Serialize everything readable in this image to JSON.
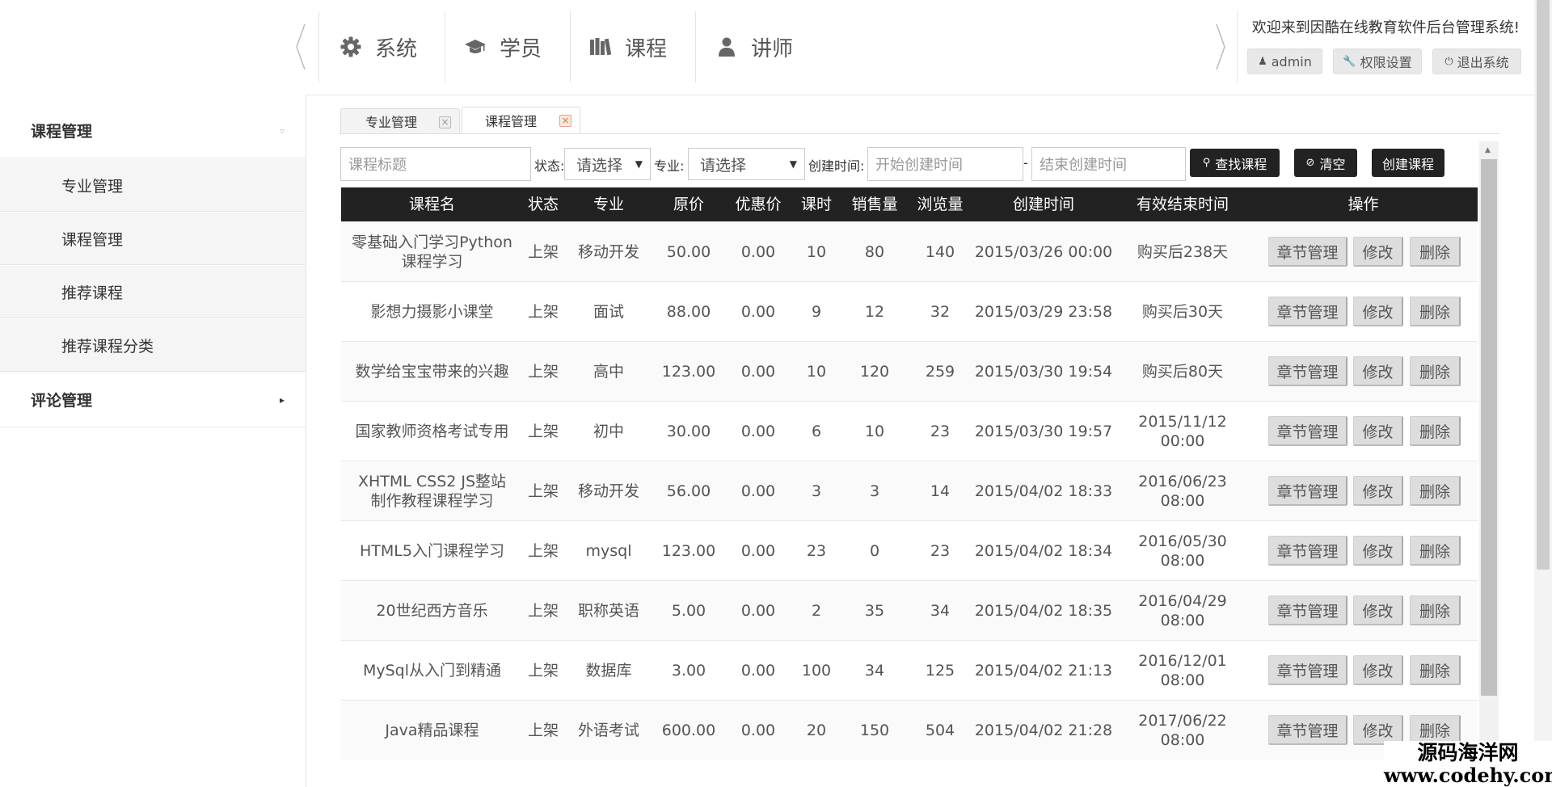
{
  "header": {
    "nav": [
      {
        "label": "系统",
        "icon": "gear-icon"
      },
      {
        "label": "学员",
        "icon": "graduation-cap-icon"
      },
      {
        "label": "课程",
        "icon": "books-icon"
      },
      {
        "label": "讲师",
        "icon": "user-icon"
      }
    ],
    "welcome": "欢迎来到因酷在线教育软件后台管理系统!",
    "buttons": {
      "admin": "admin",
      "permissions": "权限设置",
      "logout": "退出系统"
    }
  },
  "sidebar": {
    "course_group": "课程管理",
    "items": [
      "专业管理",
      "课程管理",
      "推荐课程",
      "推荐课程分类"
    ],
    "comment_group": "评论管理"
  },
  "tabs": [
    {
      "label": "专业管理",
      "active": false
    },
    {
      "label": "课程管理",
      "active": true
    }
  ],
  "filters": {
    "title_placeholder": "课程标题",
    "status_label": "状态:",
    "status_value": "请选择",
    "major_label": "专业:",
    "major_value": "请选择",
    "created_label": "创建时间:",
    "start_placeholder": "开始创建时间",
    "dash": "-",
    "end_placeholder": "结束创建时间",
    "search_button": "查找课程",
    "clear_button": "清空",
    "create_button": "创建课程"
  },
  "table": {
    "columns": [
      "课程名",
      "状态",
      "专业",
      "原价",
      "优惠价",
      "课时",
      "销售量",
      "浏览量",
      "创建时间",
      "有效结束时间",
      "操作"
    ],
    "actions": {
      "chapters": "章节管理",
      "edit": "修改",
      "delete": "删除"
    },
    "rows": [
      {
        "name": "零基础入门学习Python课程学习",
        "status": "上架",
        "major": "移动开发",
        "price": "50.00",
        "discount": "0.00",
        "hours": "10",
        "sales": "80",
        "views": "140",
        "created": "2015/03/26 00:00",
        "end": "购买后238天"
      },
      {
        "name": "影想力摄影小课堂",
        "status": "上架",
        "major": "面试",
        "price": "88.00",
        "discount": "0.00",
        "hours": "9",
        "sales": "12",
        "views": "32",
        "created": "2015/03/29 23:58",
        "end": "购买后30天"
      },
      {
        "name": "数学给宝宝带来的兴趣",
        "status": "上架",
        "major": "高中",
        "price": "123.00",
        "discount": "0.00",
        "hours": "10",
        "sales": "120",
        "views": "259",
        "created": "2015/03/30 19:54",
        "end": "购买后80天"
      },
      {
        "name": "国家教师资格考试专用",
        "status": "上架",
        "major": "初中",
        "price": "30.00",
        "discount": "0.00",
        "hours": "6",
        "sales": "10",
        "views": "23",
        "created": "2015/03/30 19:57",
        "end": "2015/11/12 00:00"
      },
      {
        "name": "XHTML CSS2 JS整站制作教程课程学习",
        "status": "上架",
        "major": "移动开发",
        "price": "56.00",
        "discount": "0.00",
        "hours": "3",
        "sales": "3",
        "views": "14",
        "created": "2015/04/02 18:33",
        "end": "2016/06/23 08:00"
      },
      {
        "name": "HTML5入门课程学习",
        "status": "上架",
        "major": "mysql",
        "price": "123.00",
        "discount": "0.00",
        "hours": "23",
        "sales": "0",
        "views": "23",
        "created": "2015/04/02 18:34",
        "end": "2016/05/30 08:00"
      },
      {
        "name": "20世纪西方音乐",
        "status": "上架",
        "major": "职称英语",
        "price": "5.00",
        "discount": "0.00",
        "hours": "2",
        "sales": "35",
        "views": "34",
        "created": "2015/04/02 18:35",
        "end": "2016/04/29 08:00"
      },
      {
        "name": "MySql从入门到精通",
        "status": "上架",
        "major": "数据库",
        "price": "3.00",
        "discount": "0.00",
        "hours": "100",
        "sales": "34",
        "views": "125",
        "created": "2015/04/02 21:13",
        "end": "2016/12/01 08:00"
      },
      {
        "name": "Java精品课程",
        "status": "上架",
        "major": "外语考试",
        "price": "600.00",
        "discount": "0.00",
        "hours": "20",
        "sales": "150",
        "views": "504",
        "created": "2015/04/02 21:28",
        "end": "2017/06/22 08:00"
      }
    ]
  },
  "watermark": {
    "line1": "源码海洋网",
    "line2": "www.codehy.com"
  }
}
